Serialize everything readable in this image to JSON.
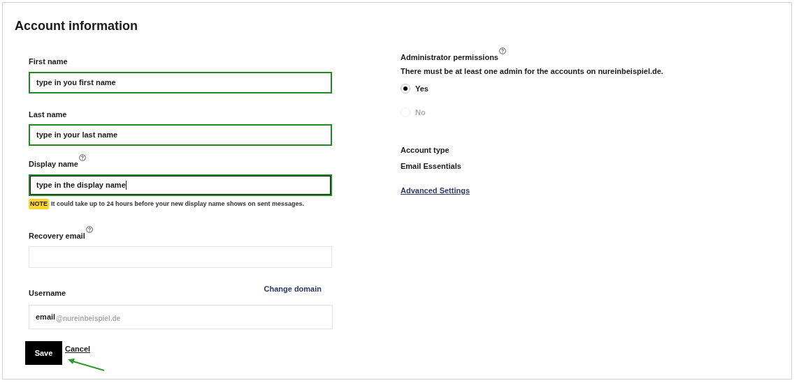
{
  "title": "Account information",
  "fields": [
    {
      "label": "First name",
      "help": false,
      "value": "type in you first name",
      "highlighted": true,
      "focused": false
    },
    {
      "label": "Last name",
      "help": false,
      "value": "type in your last name",
      "highlighted": true,
      "focused": false
    },
    {
      "label": "Display name",
      "help": true,
      "value": "type in the display name",
      "highlighted": true,
      "focused": true,
      "note": {
        "badge": "NOTE",
        "text": "It could take up to 24 hours before your new display name shows on sent messages."
      }
    },
    {
      "label": "Recovery email",
      "help": true,
      "highlighted": false,
      "focused": false
    }
  ],
  "username": {
    "label": "Username",
    "link": "Change domain",
    "value": "email",
    "suffix": "@nureinbeispiel.de"
  },
  "buttons": {
    "save": "Save",
    "cancel": "Cancel"
  },
  "admin": {
    "label": "Administrator permissions",
    "description": "There must be at least one admin for the accounts on nureinbeispiel.de.",
    "options": [
      {
        "label": "Yes",
        "selected": true,
        "disabled": false
      },
      {
        "label": "No",
        "selected": false,
        "disabled": true
      }
    ]
  },
  "account_type": {
    "label": "Account type",
    "value": "Email Essentials"
  },
  "advanced_link": "Advanced Settings"
}
